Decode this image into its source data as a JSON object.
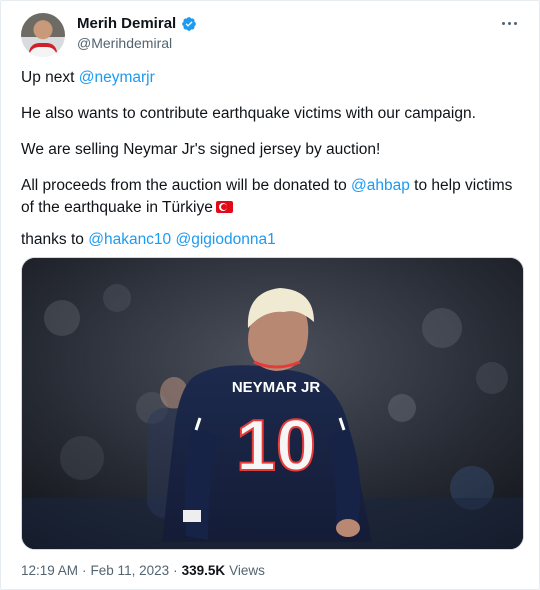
{
  "author": {
    "name": "Merih Demiral",
    "handle": "@Merihdemiral",
    "verified_color": "#1d9bf0"
  },
  "tweet": {
    "line1_prefix": "Up next ",
    "line1_mention": "@neymarjr",
    "line2": "He also wants to contribute earthquake victims with our campaign.",
    "line3": "We are selling Neymar Jr's signed jersey by auction!",
    "line4_prefix": "All proceeds from the auction will be donated to ",
    "line4_mention": "@ahbap",
    "line4_suffix": " to help victims of the earthquake in Türkiye",
    "line5_prefix": "thanks to ",
    "line5_mention1": "@hakanc10",
    "line5_mention2": "@gigiodonna1"
  },
  "image": {
    "jersey_name": "NEYMAR JR",
    "jersey_number": "10"
  },
  "meta": {
    "time": "12:19 AM",
    "separator": "·",
    "date": "Feb 11, 2023",
    "views_count": "339.5K",
    "views_label": "Views"
  },
  "colors": {
    "link": "#1d9bf0",
    "muted": "#536471",
    "text": "#0f1419"
  }
}
